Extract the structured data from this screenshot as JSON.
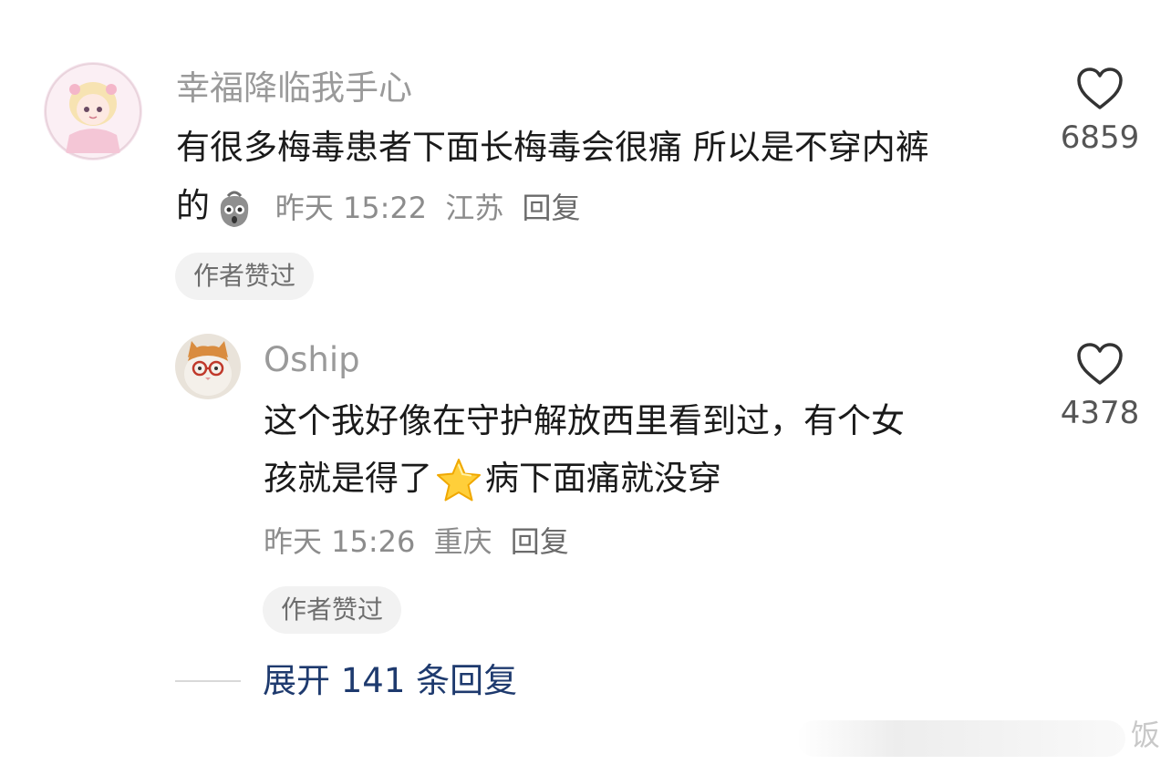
{
  "comments": [
    {
      "username": "幸福降临我手心",
      "text_line1": "有很多梅毒患者下面长梅毒会很痛 所以是不穿内裤",
      "text_line2": "的",
      "emoji": "shocked-bag-emoji",
      "time": "昨天 15:22",
      "location": "江苏",
      "reply_label": "回复",
      "badge": "作者赞过",
      "likes": "6859"
    },
    {
      "username": "Oship",
      "text_line1": "这个我好像在守护解放西里看到过，有个女",
      "text_line2_before": "孩就是得了",
      "emoji": "star-emoji",
      "text_line2_after": "病下面痛就没穿",
      "time": "昨天 15:26",
      "location": "重庆",
      "reply_label": "回复",
      "badge": "作者赞过",
      "likes": "4378"
    }
  ],
  "expand_replies": "展开 141 条回复",
  "watermark": "饭",
  "colors": {
    "username": "#9a9a9a",
    "text": "#1a1a1a",
    "meta": "#8c8c8c",
    "badge_bg": "#f2f2f2",
    "expand_link": "#1e3a6e"
  }
}
